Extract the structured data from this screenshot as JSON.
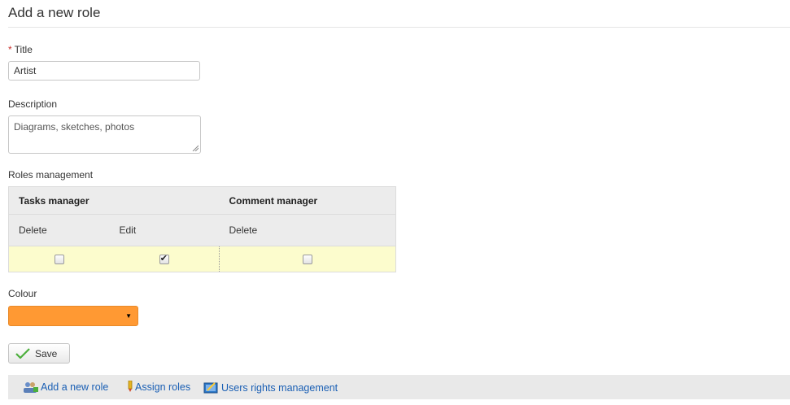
{
  "page": {
    "title": "Add a new role"
  },
  "form": {
    "title": {
      "label": "Title",
      "required_mark": "*",
      "value": "Artist"
    },
    "description": {
      "label": "Description",
      "value": "Diagrams, sketches, photos"
    },
    "roles_management": {
      "label": "Roles management",
      "groups": [
        "Tasks manager",
        "Comment manager"
      ],
      "columns": [
        {
          "group": "Tasks manager",
          "label": "Delete",
          "checked": false
        },
        {
          "group": "Tasks manager",
          "label": "Edit",
          "checked": true
        },
        {
          "group": "Comment manager",
          "label": "Delete",
          "checked": false
        }
      ]
    },
    "colour": {
      "label": "Colour",
      "value_color": "#ff9933"
    },
    "save_label": "Save"
  },
  "footer": {
    "links": [
      {
        "label": "Add a new role",
        "icon": "add-role-icon"
      },
      {
        "label": "Assign roles",
        "icon": "assign-roles-icon"
      },
      {
        "label": "Users rights management",
        "icon": "rights-management-icon"
      }
    ]
  }
}
